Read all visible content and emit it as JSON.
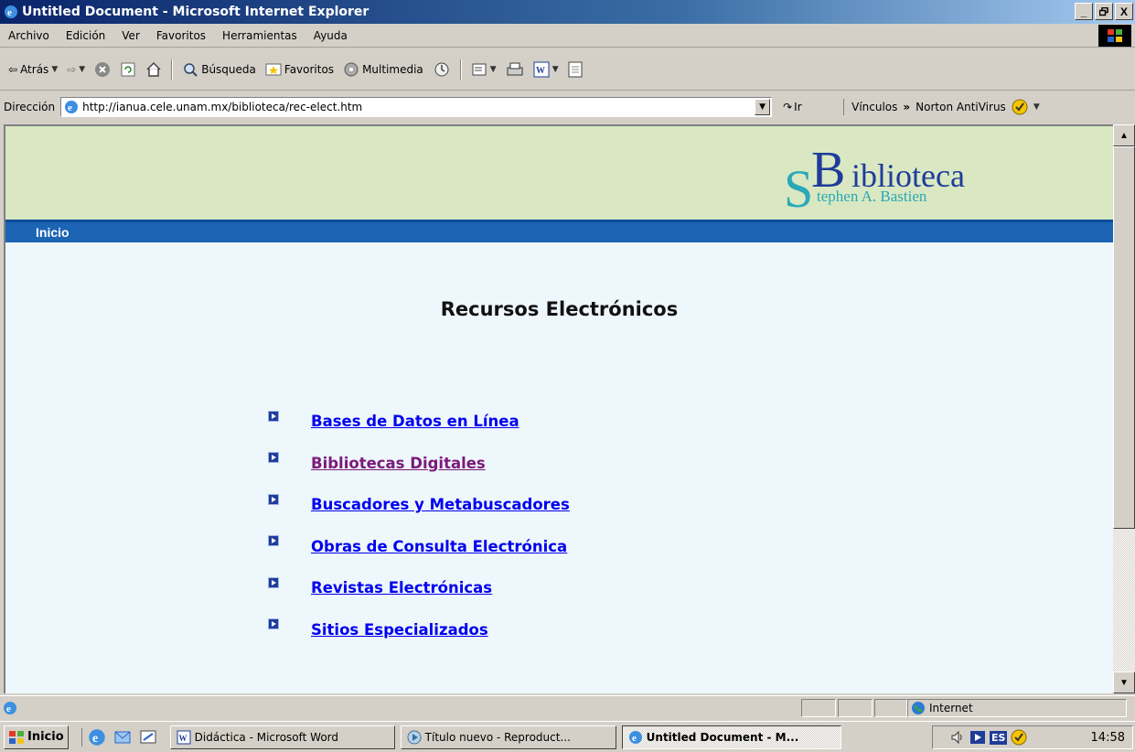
{
  "window": {
    "title": "Untitled Document - Microsoft Internet Explorer",
    "controls": [
      "_",
      "Х",
      "X"
    ]
  },
  "menu": [
    "Archivo",
    "Edición",
    "Ver",
    "Favoritos",
    "Herramientas",
    "Ayuda"
  ],
  "toolbar": {
    "back": "Atrás",
    "search": "Búsqueda",
    "favorites": "Favoritos",
    "multimedia": "Multimedia"
  },
  "address": {
    "label": "Dirección",
    "url": "http://ianua.cele.unam.mx/biblioteca/rec-elect.htm",
    "go": "Ir",
    "links": "Vínculos",
    "norton": "Norton AntiVirus"
  },
  "page": {
    "logo_initials": [
      "B",
      "S"
    ],
    "logo_line1": "iblioteca",
    "logo_line2": "tephen A. Bastien",
    "nav_home": "Inicio",
    "heading": "Recursos Electrónicos",
    "links": [
      {
        "label": "Bases de Datos en Línea",
        "visited": false
      },
      {
        "label": "Bibliotecas Digitales",
        "visited": true
      },
      {
        "label": "Buscadores y Metabuscadores",
        "visited": false
      },
      {
        "label": "Obras de Consulta Electrónica",
        "visited": false
      },
      {
        "label": "Revistas Electrónicas",
        "visited": false
      },
      {
        "label": "Sitios Especializados",
        "visited": false
      }
    ]
  },
  "status": {
    "zone": "Internet"
  },
  "taskbar": {
    "start": "Inicio",
    "tasks": [
      {
        "label": "Didáctica - Microsoft Word",
        "active": false
      },
      {
        "label": "Título nuevo - Reproduct...",
        "active": false
      },
      {
        "label": "Untitled Document - M...",
        "active": true
      }
    ],
    "lang": "ES",
    "clock": "14:58"
  },
  "colors": {
    "banner": "#d9e8c2",
    "nav_strip": "#1c64b4",
    "page_bg": "#eef7fc",
    "link": "#0000ee",
    "visited_link": "#7a1a7a",
    "logo_teal": "#2aa8b8"
  }
}
